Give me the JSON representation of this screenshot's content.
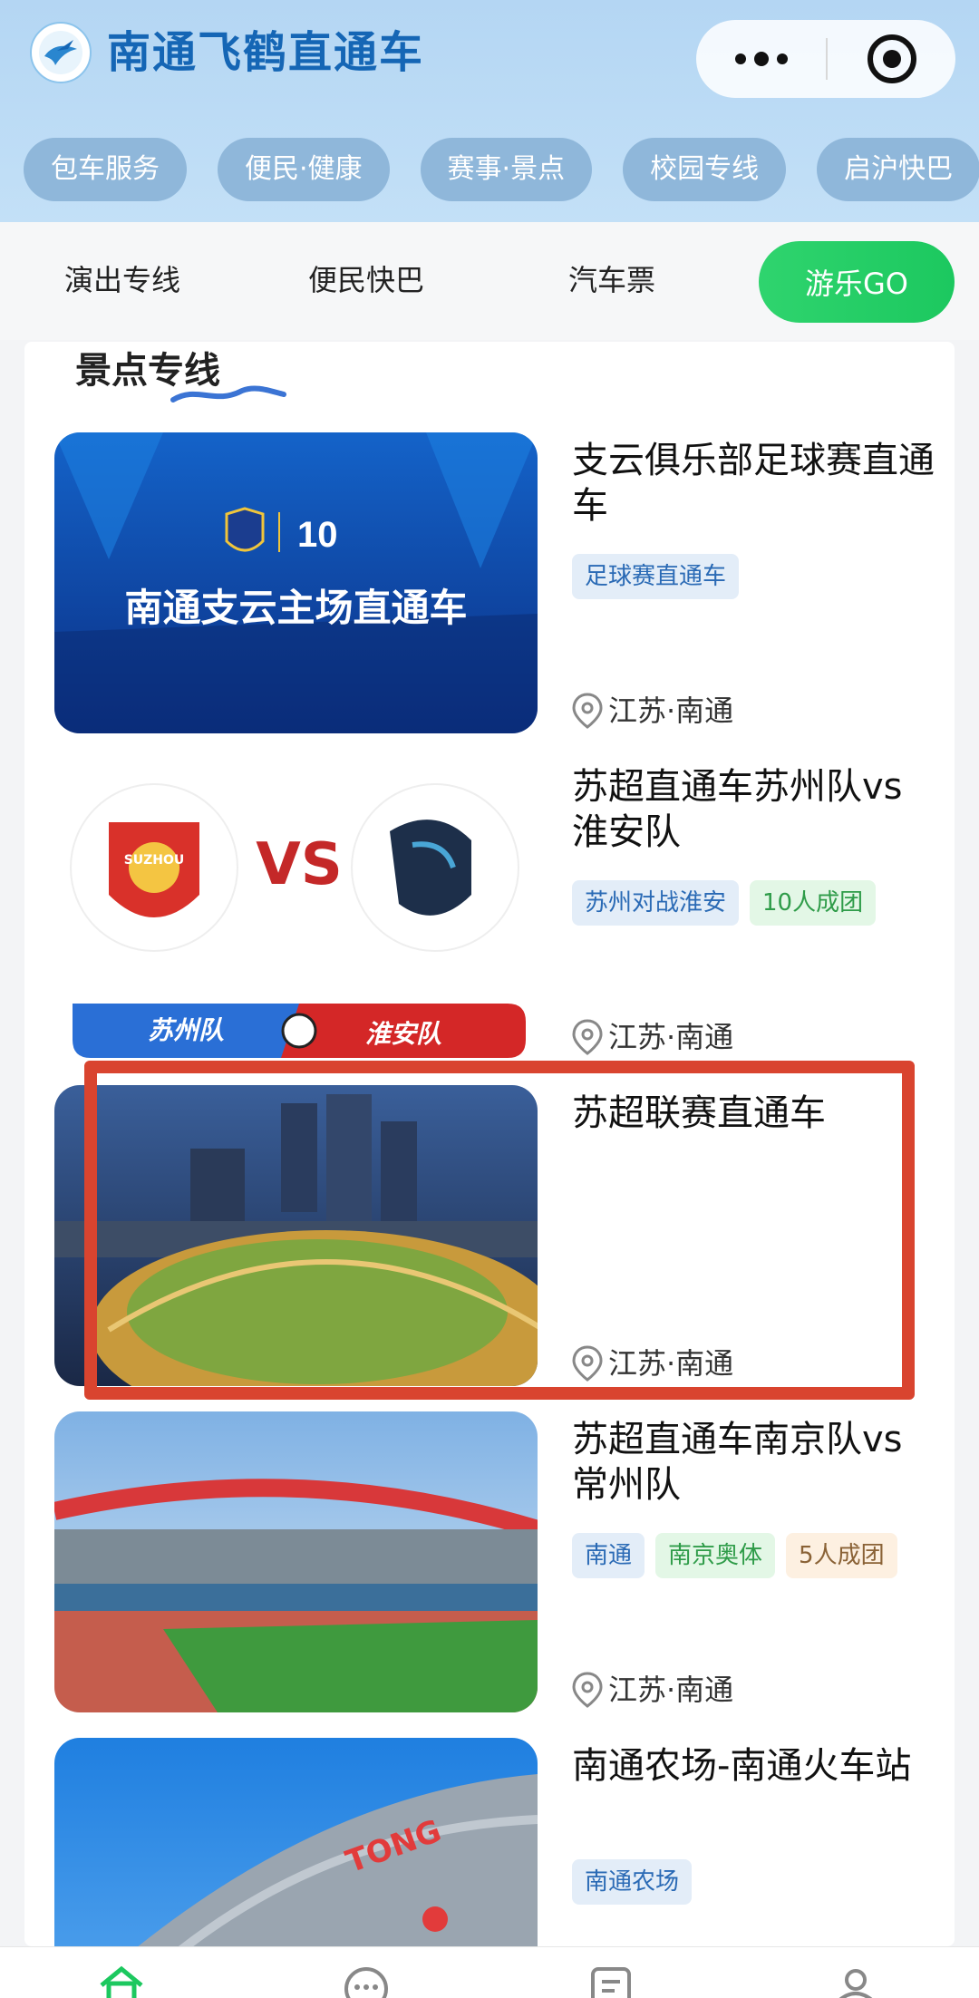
{
  "header": {
    "app_title": "南通飞鹤直通车",
    "logo_icon": "crane-logo-icon",
    "more_icon": "more-dots-icon",
    "close_icon": "mini-program-close-icon"
  },
  "categories": [
    "包车服务",
    "便民·健康",
    "赛事·景点",
    "校园专线",
    "启沪快巴"
  ],
  "subtabs": {
    "items": [
      "演出专线",
      "便民快巴",
      "汽车票"
    ],
    "active": "游乐GO"
  },
  "section": {
    "title": "景点专线"
  },
  "items": [
    {
      "title": "支云俱乐部足球赛直通车",
      "image_caption": "南通支云主场直通车",
      "badge_text": "10",
      "tags": [
        {
          "text": "足球赛直通车",
          "color": "blue"
        }
      ],
      "location": "江苏·南通"
    },
    {
      "title": "苏超直通车苏州队vs淮安队",
      "image_vs": "VS",
      "team_left": "苏州队",
      "team_right": "淮安队",
      "left_logo_text": "SUZHOU",
      "tags": [
        {
          "text": "苏州对战淮安",
          "color": "blue"
        },
        {
          "text": "10人成团",
          "color": "green"
        }
      ],
      "location": "江苏·南通"
    },
    {
      "title": "苏超联赛直通车",
      "tags": [],
      "location": "江苏·南通"
    },
    {
      "title": "苏超直通车南京队vs常州队",
      "tags": [
        {
          "text": "南通",
          "color": "blue"
        },
        {
          "text": "南京奥体",
          "color": "green"
        },
        {
          "text": "5人成团",
          "color": "orange"
        }
      ],
      "location": "江苏·南通"
    },
    {
      "title": "南通农场-南通火车站",
      "image_sign": "TONG",
      "tags": [
        {
          "text": "南通农场",
          "color": "blue"
        }
      ],
      "location": ""
    }
  ],
  "bottom_nav": [
    "home-icon",
    "message-icon",
    "orders-icon",
    "profile-icon"
  ],
  "colors": {
    "brand": "#1566b5",
    "active_green": "#1cc85f",
    "highlight_red": "#d9442f"
  }
}
